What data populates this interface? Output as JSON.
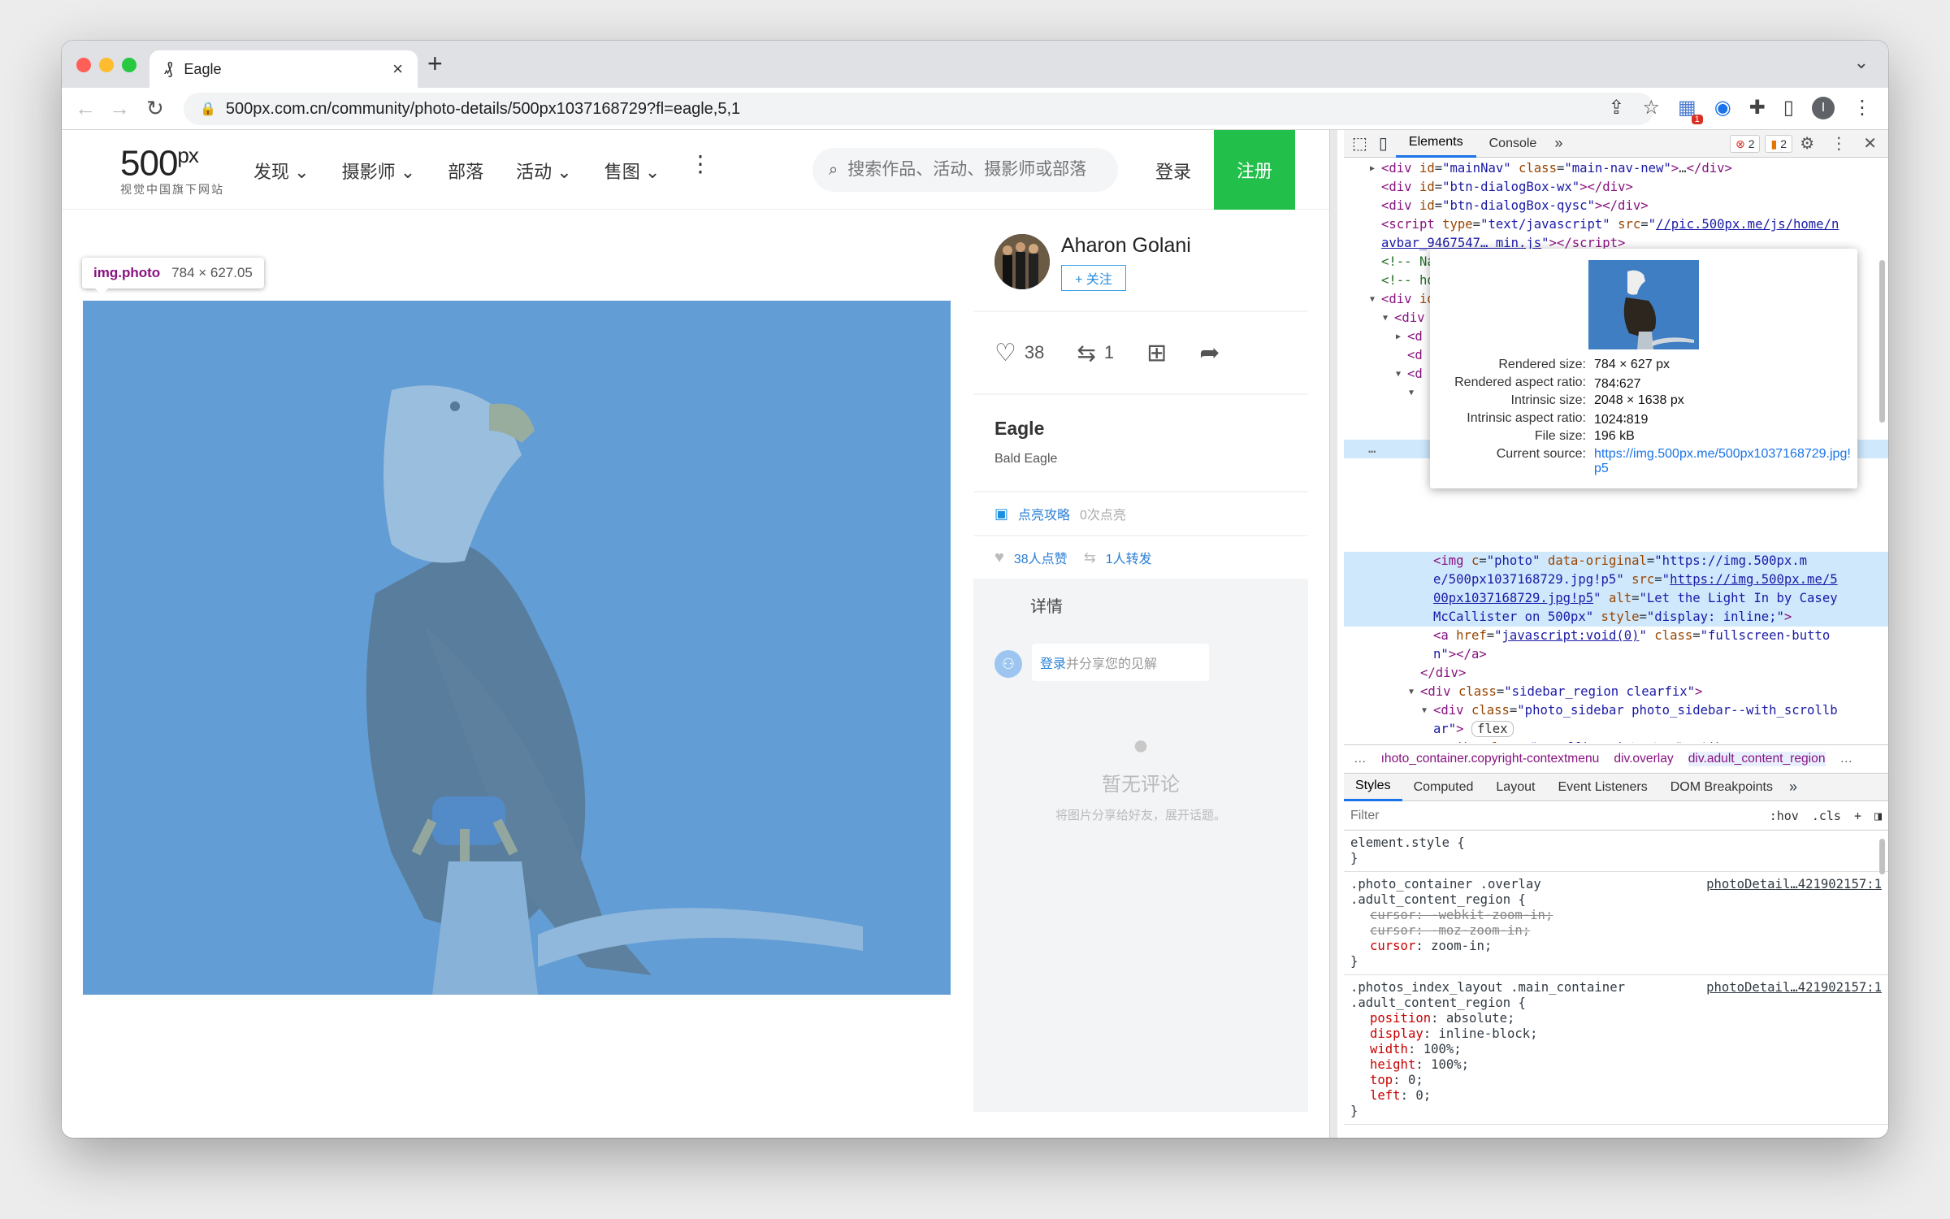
{
  "browser": {
    "tab_title": "Eagle",
    "url": "500px.com.cn/community/photo-details/500px1037168729?fl=eagle,5,1",
    "ext_badge": "1",
    "profile_initial": "I"
  },
  "site": {
    "logo_text": "500",
    "logo_suffix": "px",
    "logo_tagline": "视觉中国旗下网站",
    "menu": [
      "发现",
      "摄影师",
      "部落",
      "活动",
      "售图"
    ],
    "menu_has_chevron": [
      true,
      true,
      false,
      true,
      true
    ],
    "search_placeholder": "搜索作品、活动、摄影师或部落",
    "login": "登录",
    "register": "注册"
  },
  "inspect_tooltip": {
    "tag": "img.photo",
    "size": "784 × 627.05"
  },
  "sidebar": {
    "author": "Aharon Golani",
    "follow": "+ 关注",
    "likes": "38",
    "reposts": "1",
    "photo_title": "Eagle",
    "photo_subtitle": "Bald Eagle",
    "light_label": "点亮攻略",
    "light_count": "0次点亮",
    "liked_by": "38人点赞",
    "reposted_by": "1人转发",
    "detail_tab": "详情",
    "comment_login": "登录",
    "comment_prompt": "并分享您的见解",
    "no_comment": "暂无评论",
    "no_comment_hint": "将图片分享给好友，展开话题。"
  },
  "devtools": {
    "tabs": [
      "Elements",
      "Console"
    ],
    "error_count": "2",
    "warning_count": "2",
    "dom_lines": [
      {
        "indent": 1,
        "arrow": "▶",
        "html": "<span class=tg>&lt;div</span> <span class=at>id</span>=<span class=av>\"mainNav\"</span> <span class=at>class</span>=<span class=av>\"main-nav-new\"</span><span class=tg>&gt;</span>…<span class=tg>&lt;/div&gt;</span>"
      },
      {
        "indent": 1,
        "arrow": "",
        "html": "<span class=tg>&lt;div</span> <span class=at>id</span>=<span class=av>\"btn-dialogBox-wx\"</span><span class=tg>&gt;&lt;/div&gt;</span>"
      },
      {
        "indent": 1,
        "arrow": "",
        "html": "<span class=tg>&lt;div</span> <span class=at>id</span>=<span class=av>\"btn-dialogBox-qysc\"</span><span class=tg>&gt;&lt;/div&gt;</span>"
      },
      {
        "indent": 1,
        "arrow": "",
        "html": "<span class=tg>&lt;script</span> <span class=at>type</span>=<span class=av>\"text/javascript\"</span> <span class=at>src</span>=<span class=av>\"</span><span class=lk>//pic.500px.me/js/home/n</span>"
      },
      {
        "indent": 1,
        "arrow": "",
        "html": "<span class=lk>avbar_9467547… min.js</span><span class=av>\"</span><span class=tg>&gt;&lt;/script&gt;</span>"
      },
      {
        "indent": 1,
        "arrow": "",
        "html": "<span class=cm>&lt;!-- Navbar ends --&gt;</span>"
      },
      {
        "indent": 1,
        "arrow": "",
        "html": "<span class=cm>&lt;!-- home starts --&gt;</span>"
      },
      {
        "indent": 1,
        "arrow": "▼",
        "html": "<span class=tg>&lt;div</span> <span class=at>id</span>=<span class=av>\"content\"</span><span class=tg>&gt;</span>"
      },
      {
        "indent": 2,
        "arrow": "▼",
        "html": "<span class=tg>&lt;div</span>"
      },
      {
        "indent": 3,
        "arrow": "▶",
        "html": "<span class=tg>&lt;d</span>"
      },
      {
        "indent": 3,
        "arrow": "",
        "html": "<span class=tg>&lt;d</span>"
      },
      {
        "indent": 3,
        "arrow": "▼",
        "html": "<span class=tg>&lt;d</span>"
      },
      {
        "indent": 4,
        "arrow": "▼",
        "html": ""
      },
      {
        "indent": 4,
        "arrow": "",
        "html": ""
      },
      {
        "indent": 4,
        "arrow": "",
        "html": ""
      },
      {
        "indent": 0,
        "arrow": "",
        "html": "<span style=\"color:#666\">…</span>",
        "selected": true
      },
      {
        "indent": 4,
        "arrow": "",
        "html": ""
      },
      {
        "indent": 4,
        "arrow": "",
        "html": ""
      },
      {
        "indent": 4,
        "arrow": "",
        "html": ""
      },
      {
        "indent": 4,
        "arrow": "",
        "html": ""
      },
      {
        "indent": 4,
        "arrow": "",
        "html": ""
      },
      {
        "indent": 5,
        "arrow": "",
        "html": "<span class=tg>&lt;img</span> <span class=at>c</span>=<span class=av>\"photo\"</span> <span class=at>data-original</span>=<span class=av>\"https://img.500px.m</span>",
        "selected": true
      },
      {
        "indent": 5,
        "arrow": "",
        "html": "<span class=av>e/500px1037168729.jpg!p5\"</span> <span class=at>src</span>=<span class=av>\"</span><span class=lk>https://img.500px.me/5</span>",
        "selected": true
      },
      {
        "indent": 5,
        "arrow": "",
        "html": "<span class=lk>00px1037168729.jpg!p5</span><span class=av>\"</span> <span class=at>alt</span>=<span class=av>\"Let the Light In by Casey</span>",
        "selected": true
      },
      {
        "indent": 5,
        "arrow": "",
        "html": "<span class=av>McCallister on 500px\"</span> <span class=at>style</span>=<span class=av>\"display: inline;\"</span><span class=tg>&gt;</span>",
        "selected": true
      },
      {
        "indent": 5,
        "arrow": "",
        "html": "<span class=tg>&lt;a</span> <span class=at>href</span>=<span class=av>\"</span><span class=lk>javascript:void(0)</span><span class=av>\"</span> <span class=at>class</span>=<span class=av>\"fullscreen-butto</span>"
      },
      {
        "indent": 5,
        "arrow": "",
        "html": "<span class=av>n\"</span><span class=tg>&gt;&lt;/a&gt;</span>"
      },
      {
        "indent": 4,
        "arrow": "",
        "html": "<span class=tg>&lt;/div&gt;</span>"
      },
      {
        "indent": 4,
        "arrow": "▼",
        "html": "<span class=tg>&lt;div</span> <span class=at>class</span>=<span class=av>\"sidebar_region clearfix\"</span><span class=tg>&gt;</span>"
      },
      {
        "indent": 5,
        "arrow": "▼",
        "html": "<span class=tg>&lt;div</span> <span class=at>class</span>=<span class=av>\"photo_sidebar photo_sidebar--with_scrollb</span>"
      },
      {
        "indent": 5,
        "arrow": "",
        "html": "<span class=av>ar\"</span><span class=tg>&gt;</span> <span style=\"border:1px solid #bbb;border-radius:8px;padding:0 6px;color:#333\">flex</span>"
      },
      {
        "indent": 6,
        "arrow": "",
        "html": "<span class=tg>&lt;div</span> <span class=at>class</span>=<span class=av>\"scrollbar_detector\"</span><span class=tg>&gt;&lt;/div&gt;</span>"
      }
    ],
    "image_info": {
      "rows": [
        {
          "k": "Rendered size:",
          "v": "784 × 627 px"
        },
        {
          "k": "Rendered aspect ratio:",
          "v": "784∶627"
        },
        {
          "k": "Intrinsic size:",
          "v": "2048 × 1638 px"
        },
        {
          "k": "Intrinsic aspect ratio:",
          "v": "1024∶819"
        },
        {
          "k": "File size:",
          "v": "196 kB"
        },
        {
          "k": "Current source:",
          "v": "https://img.500px.me/500px1037168729.jpg!p5",
          "link": true
        }
      ]
    },
    "breadcrumbs": [
      "…",
      "ıhoto_container.copyright-contextmenu",
      "div.overlay",
      "div.adult_content_region",
      "…"
    ],
    "style_tabs": [
      "Styles",
      "Computed",
      "Layout",
      "Event Listeners",
      "DOM Breakpoints"
    ],
    "filter_placeholder": "Filter",
    "hov": ":hov",
    "cls": ".cls",
    "rules": [
      {
        "selector": [
          "element.style {"
        ],
        "source": "",
        "props": []
      },
      {
        "selector": [
          ".photo_container .overlay",
          ".adult_content_region {"
        ],
        "source": "photoDetail…421902157:1",
        "props": [
          {
            "name": "cursor",
            "value": "-webkit-zoom-in;",
            "struck": true
          },
          {
            "name": "cursor",
            "value": "-moz-zoom-in;",
            "struck": true
          },
          {
            "name": "cursor",
            "value": "zoom-in;",
            "struck": false
          }
        ]
      },
      {
        "selector": [
          ".photos_index_layout .main_container",
          ".adult_content_region {"
        ],
        "source": "photoDetail…421902157:1",
        "props": [
          {
            "name": "position",
            "value": "absolute;",
            "struck": false
          },
          {
            "name": "display",
            "value": "inline-block;",
            "struck": false
          },
          {
            "name": "width",
            "value": "100%;",
            "struck": false
          },
          {
            "name": "height",
            "value": "100%;",
            "struck": false
          },
          {
            "name": "top",
            "value": "0;",
            "struck": false
          },
          {
            "name": "left",
            "value": "0;",
            "struck": false
          }
        ]
      }
    ]
  }
}
